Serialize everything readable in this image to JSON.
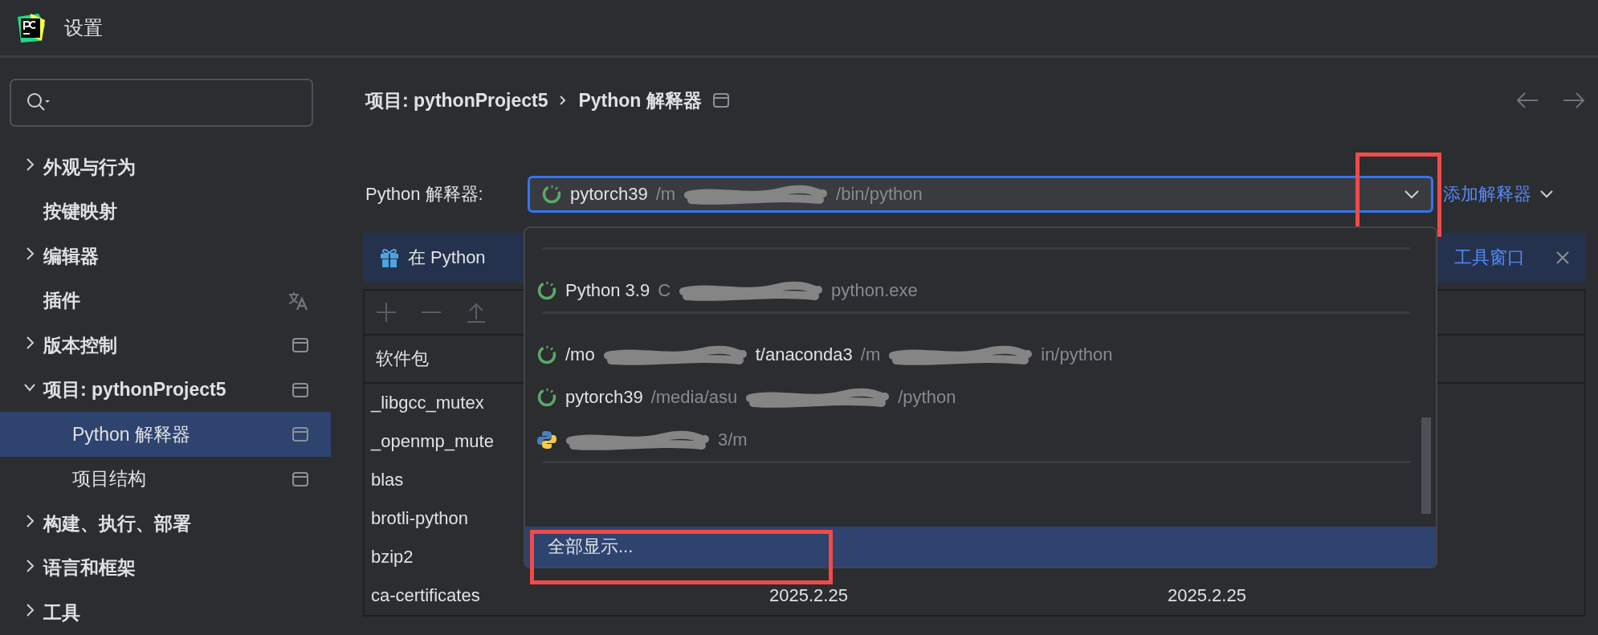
{
  "window": {
    "title": "设置"
  },
  "sidebar": {
    "items": [
      {
        "kind": "group",
        "label": "外观与行为",
        "expanded": false,
        "selected": false
      },
      {
        "kind": "leaf",
        "label": "按键映射",
        "selected": false
      },
      {
        "kind": "group",
        "label": "编辑器",
        "expanded": false,
        "selected": false
      },
      {
        "kind": "leaf",
        "label": "插件",
        "selected": false
      },
      {
        "kind": "group",
        "label": "版本控制",
        "expanded": false,
        "selected": false
      },
      {
        "kind": "group",
        "label": "项目: pythonProject5",
        "expanded": true,
        "selected": false,
        "children": [
          {
            "label": "Python 解释器",
            "selected": true
          },
          {
            "label": "项目结构",
            "selected": false
          }
        ]
      },
      {
        "kind": "group",
        "label": "构建、执行、部署",
        "expanded": false,
        "selected": false
      },
      {
        "kind": "group",
        "label": "语言和框架",
        "expanded": false,
        "selected": false
      },
      {
        "kind": "group",
        "label": "工具",
        "expanded": false,
        "selected": false
      }
    ]
  },
  "breadcrumb": [
    "项目: pythonProject5",
    "Python 解释器"
  ],
  "interpreter": {
    "label": "Python 解释器:",
    "segments": [
      {
        "kind": "name",
        "text": "pytorch39"
      },
      {
        "kind": "path",
        "text": "/m"
      },
      {
        "kind": "redacted"
      },
      {
        "kind": "path",
        "text": "/bin/python"
      }
    ],
    "add_link": "添加解释器"
  },
  "banner": {
    "text_start": "在 Python",
    "text_end": "工具窗口"
  },
  "packages": {
    "columns": [
      "软件包"
    ],
    "rows": [
      [
        "_libgcc_mutex"
      ],
      [
        "_openmp_mute"
      ],
      [
        "blas"
      ],
      [
        "brotli-python"
      ],
      [
        "bzip2"
      ],
      [
        "ca-certificates",
        "2025.2.25",
        "2025.2.25"
      ]
    ]
  },
  "dropdown": {
    "items": [
      {
        "kind": "separator"
      },
      {
        "kind": "conda",
        "segments": [
          {
            "kind": "name",
            "text": "Python 3.9"
          },
          {
            "kind": "path",
            "text": "C"
          },
          {
            "kind": "redacted"
          },
          {
            "kind": "path",
            "text": "python.exe"
          }
        ]
      },
      {
        "kind": "separator"
      },
      {
        "kind": "conda",
        "segments": [
          {
            "kind": "name",
            "text": "/mo"
          },
          {
            "kind": "redacted"
          },
          {
            "kind": "name",
            "text": "t/anaconda3"
          },
          {
            "kind": "path",
            "text": "/m"
          },
          {
            "kind": "redacted"
          },
          {
            "kind": "path",
            "text": "in/python"
          }
        ]
      },
      {
        "kind": "conda",
        "segments": [
          {
            "kind": "name",
            "text": "pytorch39"
          },
          {
            "kind": "path",
            "text": "/media/asu"
          },
          {
            "kind": "redacted"
          },
          {
            "kind": "path",
            "text": "/python"
          }
        ]
      },
      {
        "kind": "venv",
        "segments": [
          {
            "kind": "redacted"
          },
          {
            "kind": "path",
            "text": "3/m"
          }
        ]
      },
      {
        "kind": "separator"
      }
    ],
    "show_all": {
      "label": "全部显示...",
      "selected": true
    }
  }
}
